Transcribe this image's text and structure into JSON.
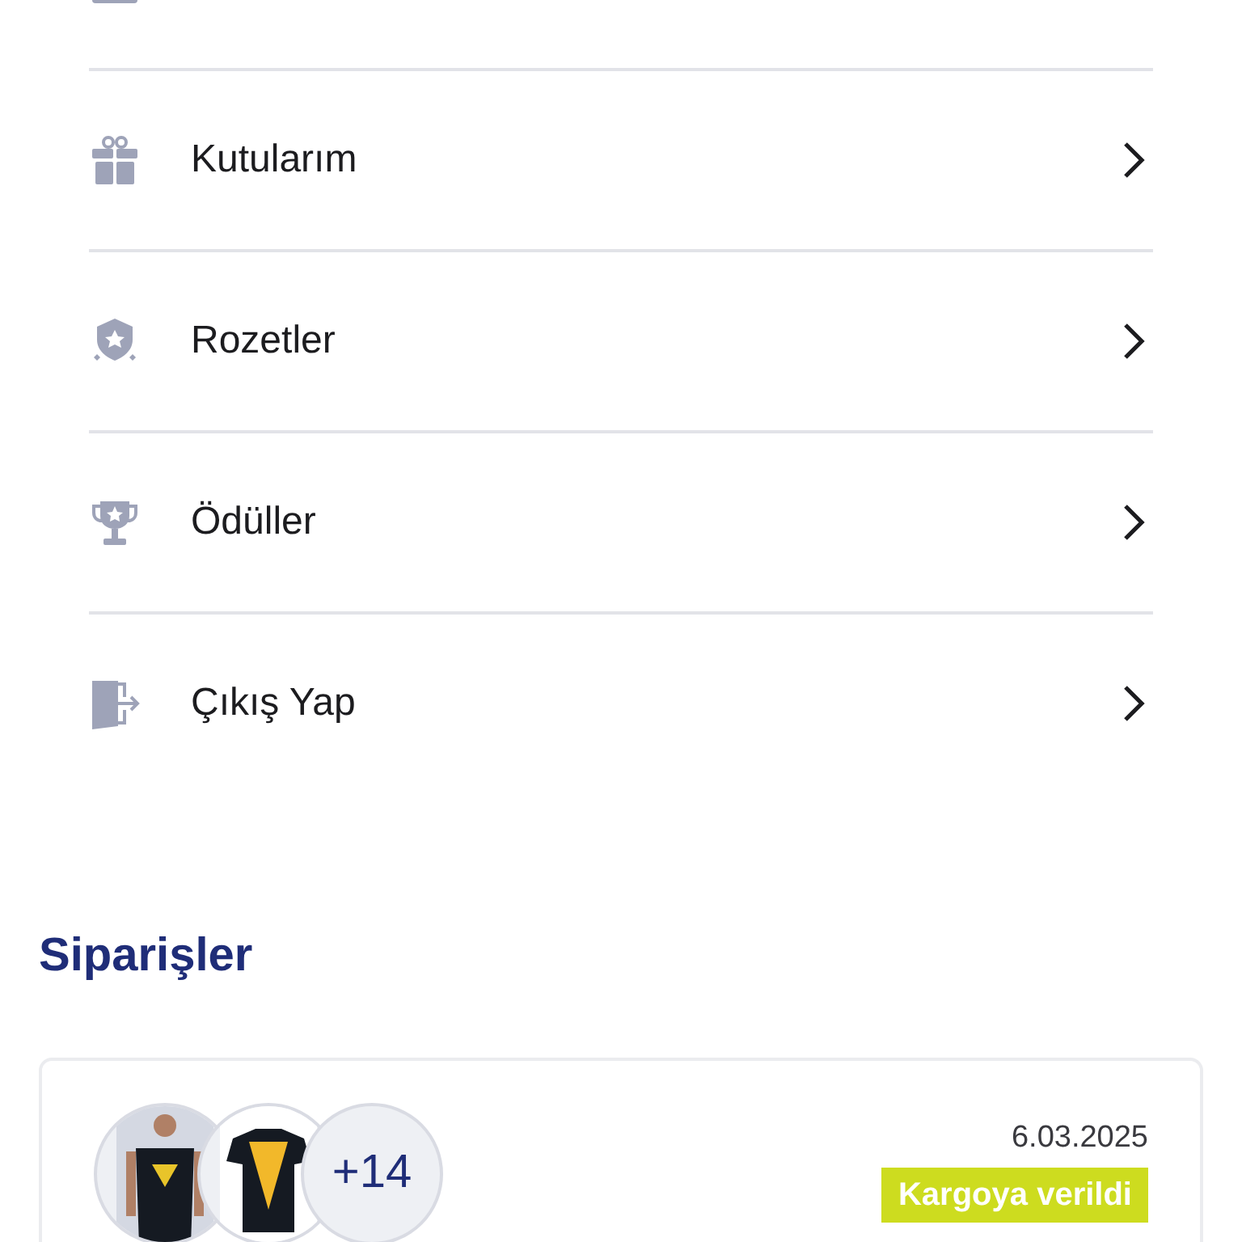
{
  "menu_items": [
    {
      "kind": "gift",
      "label": "Kutularım"
    },
    {
      "kind": "badge",
      "label": "Rozetler"
    },
    {
      "kind": "trophy",
      "label": "Ödüller"
    },
    {
      "kind": "exit",
      "label": "Çıkış Yap"
    }
  ],
  "orders": {
    "title": "Siparişler",
    "items": [
      {
        "more_count": "+14",
        "date": "6.03.2025",
        "status": "Kargoya verildi",
        "color": "#cddc1f"
      }
    ]
  }
}
